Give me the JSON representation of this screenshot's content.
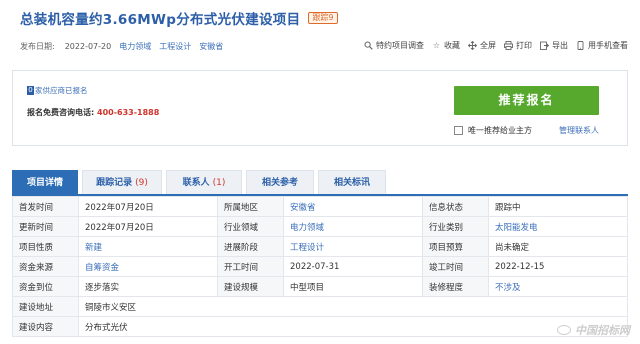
{
  "project": {
    "title": "总装机容量约3.66MWp分布式光伏建设项目",
    "track_badge": "跟踪9"
  },
  "meta": {
    "publish_label": "发布日期:",
    "publish_date": "2022-07-20",
    "tags": [
      "电力领域",
      "工程设计",
      "安徽省"
    ]
  },
  "tools": [
    {
      "icon": "search-icon",
      "label": "特约项目调查"
    },
    {
      "icon": "star-icon",
      "label": "收藏"
    },
    {
      "icon": "fullscreen-icon",
      "label": "全屏"
    },
    {
      "icon": "print-icon",
      "label": "打印"
    },
    {
      "icon": "export-icon",
      "label": "导出"
    },
    {
      "icon": "phone-icon",
      "label": "用手机查看"
    }
  ],
  "supplier": {
    "count": "0",
    "text": "家供应商已报名"
  },
  "hotline": {
    "label": "报名免费咨询电话:",
    "phone": "400-633-1888"
  },
  "recommend": {
    "button": "推荐报名",
    "option": "唯一推荐给业主方",
    "manage_link": "管理联系人"
  },
  "tabs": [
    {
      "label": "项目详情",
      "count": ""
    },
    {
      "label": "跟踪记录",
      "count": "(9)"
    },
    {
      "label": "联系人",
      "count": "(1)"
    },
    {
      "label": "相关参考",
      "count": ""
    },
    {
      "label": "相关标讯",
      "count": ""
    }
  ],
  "details": {
    "rows": [
      [
        {
          "label": "首发时间",
          "value": "2022年07月20日"
        },
        {
          "label": "所属地区",
          "value": "安徽省"
        },
        {
          "label": "信息状态",
          "value": "跟踪中"
        }
      ],
      [
        {
          "label": "更新时间",
          "value": "2022年07月20日"
        },
        {
          "label": "行业领域",
          "value": "电力领域"
        },
        {
          "label": "行业类别",
          "value": "太阳能发电"
        }
      ],
      [
        {
          "label": "项目性质",
          "value": "新建"
        },
        {
          "label": "进展阶段",
          "value": "工程设计"
        },
        {
          "label": "项目预算",
          "value": "尚未确定"
        }
      ],
      [
        {
          "label": "资金来源",
          "value": "自筹资金"
        },
        {
          "label": "开工时间",
          "value": "2022-07-31"
        },
        {
          "label": "竣工时间",
          "value": "2022-12-15"
        }
      ],
      [
        {
          "label": "资金到位",
          "value": "逐步落实"
        },
        {
          "label": "建设规模",
          "value": "中型项目"
        },
        {
          "label": "装修程度",
          "value": "不涉及"
        }
      ]
    ],
    "address_label": "建设地址",
    "address_value": "铜陵市义安区",
    "content_label": "建设内容",
    "content_value": "分布式光伏"
  },
  "watermark": "中国招标网"
}
